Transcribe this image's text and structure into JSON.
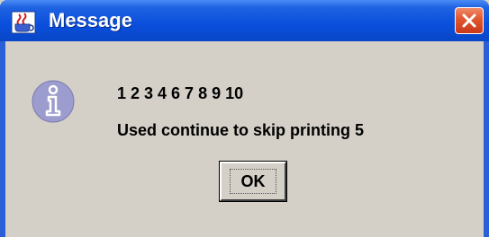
{
  "window": {
    "title": "Message",
    "icons": {
      "app": "java-cup-icon",
      "close": "close-icon",
      "message": "info-icon"
    }
  },
  "message": {
    "line1": "1 2 3 4 6 7 8 9 10",
    "line2": "Used continue to skip printing 5"
  },
  "buttons": {
    "ok_label": "OK"
  },
  "colors": {
    "titlebar": "#0a4fdc",
    "dialog_bg": "#d4d0c8",
    "close_button": "#e0552e",
    "info_icon": "#9c9ccf"
  }
}
